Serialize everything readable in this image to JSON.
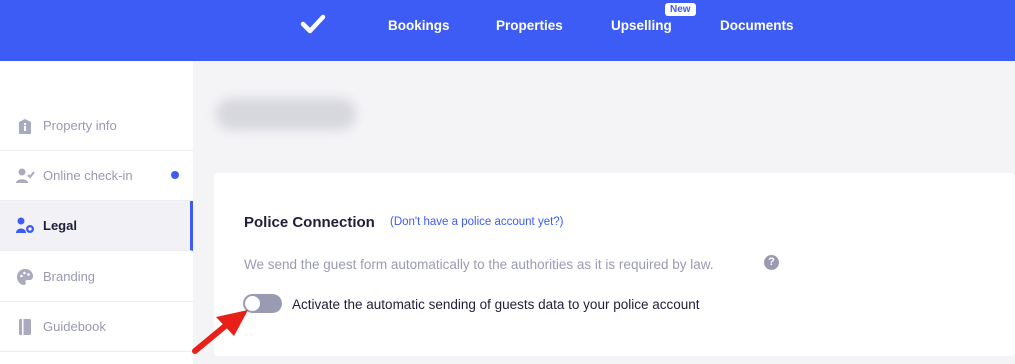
{
  "nav": {
    "items": [
      {
        "label": "Bookings"
      },
      {
        "label": "Properties"
      },
      {
        "label": "Upselling",
        "badge": "New"
      },
      {
        "label": "Documents"
      }
    ],
    "logo_icon": "checkmark-icon",
    "bg_color": "#3d5cf5"
  },
  "sidebar": {
    "items": [
      {
        "label": "Property info",
        "icon": "building-icon"
      },
      {
        "label": "Online check-in",
        "icon": "user-check-icon",
        "has_dot": true
      },
      {
        "label": "Legal",
        "icon": "legal-icon",
        "active": true
      },
      {
        "label": "Branding",
        "icon": "palette-icon"
      },
      {
        "label": "Guidebook",
        "icon": "book-icon"
      }
    ]
  },
  "card": {
    "title": "Police Connection",
    "link": "(Don't have a police account yet?)",
    "description": "We send the guest form automatically to the authorities as it is required by law.",
    "help_icon": "?",
    "toggle": {
      "label": "Activate the automatic sending of guests data to your police account",
      "enabled": false
    }
  },
  "colors": {
    "accent": "#3d5cf5",
    "muted": "#9a9ab3",
    "annotation_arrow": "#e8201a"
  }
}
